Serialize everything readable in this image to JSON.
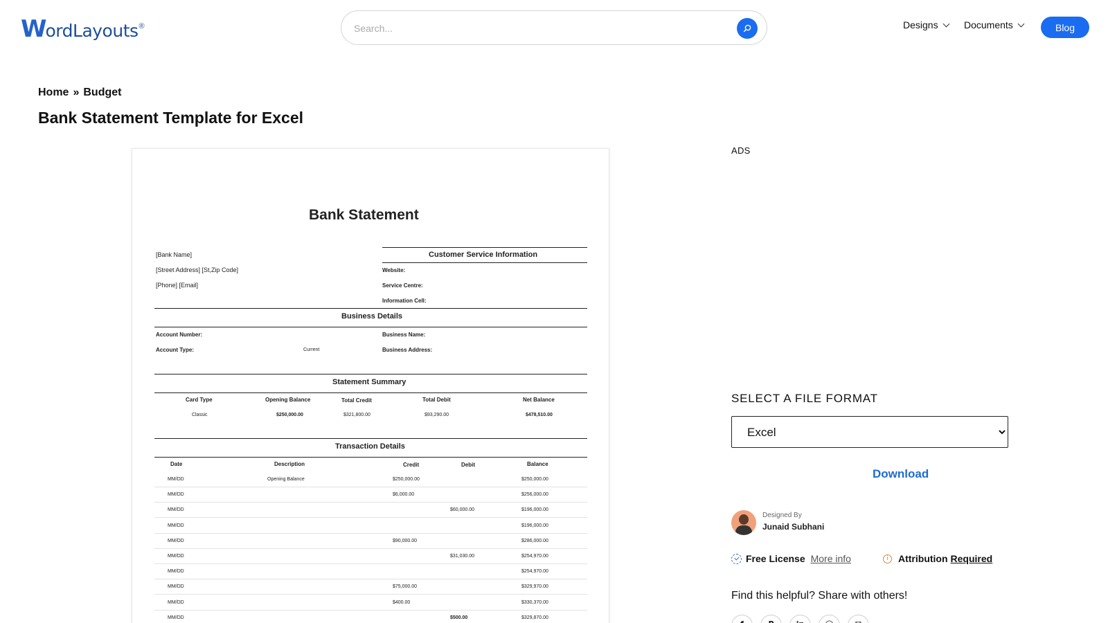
{
  "header": {
    "logo_first": "W",
    "logo_rest": "ordLayouts",
    "logo_reg": "®",
    "search_placeholder": "Search...",
    "nav": [
      {
        "label": "Designs"
      },
      {
        "label": "Documents"
      }
    ],
    "blog_label": "Blog"
  },
  "breadcrumb": {
    "home": "Home",
    "separator": "»",
    "current": "Budget"
  },
  "page_title": "Bank Statement Template for Excel",
  "document": {
    "title": "Bank Statement",
    "bank_lines": [
      "[Bank Name]",
      "[Street Address] [St,Zip Code]",
      "[Phone] [Email]"
    ],
    "customer_service": {
      "heading": "Customer Service Information",
      "fields": [
        "Website:",
        "Service Centre:",
        "Information Cell:"
      ]
    },
    "business_details": {
      "heading": "Business Details",
      "account_number_label": "Account Number:",
      "account_type_label": "Account Type:",
      "account_type_value": "Current",
      "business_name_label": "Business Name:",
      "business_address_label": "Business Address:"
    },
    "statement_summary": {
      "heading": "Statement Summary",
      "columns": [
        "Card Type",
        "Opening Balance",
        "Total Credit",
        "Total Debit",
        "Net Balance"
      ],
      "row": [
        "Classic",
        "$250,000.00",
        "$321,800.00",
        "$93,290.00",
        "$478,510.00"
      ]
    },
    "transactions": {
      "heading": "Transaction Details",
      "columns": [
        "Date",
        "Description",
        "Credit",
        "Debit",
        "Balance"
      ],
      "rows": [
        {
          "date": "MM/DD",
          "description": "Opening Balance",
          "credit": "$250,000.00",
          "debit": "",
          "balance": "$250,000.00"
        },
        {
          "date": "MM/DD",
          "description": "",
          "credit": "$6,000.00",
          "debit": "",
          "balance": "$256,000.00"
        },
        {
          "date": "MM/DD",
          "description": "",
          "credit": "",
          "debit": "$60,000.00",
          "balance": "$196,000.00"
        },
        {
          "date": "MM/DD",
          "description": "",
          "credit": "",
          "debit": "",
          "balance": "$196,000.00"
        },
        {
          "date": "MM/DD",
          "description": "",
          "credit": "$90,000.00",
          "debit": "",
          "balance": "$286,000.00"
        },
        {
          "date": "MM/DD",
          "description": "",
          "credit": "",
          "debit": "$31,030.00",
          "balance": "$254,970.00"
        },
        {
          "date": "MM/DD",
          "description": "",
          "credit": "",
          "debit": "",
          "balance": "$254,970.00"
        },
        {
          "date": "MM/DD",
          "description": "",
          "credit": "$75,000.00",
          "debit": "",
          "balance": "$329,970.00"
        },
        {
          "date": "MM/DD",
          "description": "",
          "credit": "$400.00",
          "debit": "",
          "balance": "$330,370.00"
        },
        {
          "date": "MM/DD",
          "description": "",
          "credit": "",
          "debit": "$500.00",
          "balance": "$329,870.00"
        }
      ]
    }
  },
  "sidebar": {
    "ads_label": "ADS",
    "select_label": "SELECT A FILE FORMAT",
    "formats": [
      "Excel"
    ],
    "selected_format": "Excel",
    "download_label": "Download",
    "designed_by_label": "Designed By",
    "designer_name": "Junaid Subhani",
    "license_label": "Free License",
    "more_info_label": "More info",
    "attribution_label": "Attribution",
    "attribution_link": "Required",
    "share_text": "Find this helpful? Share with others!",
    "share_icons": [
      {
        "name": "facebook-icon",
        "glyph": "f"
      },
      {
        "name": "pinterest-icon",
        "glyph": "P"
      },
      {
        "name": "linkedin-icon",
        "glyph": "in"
      },
      {
        "name": "whatsapp-icon",
        "glyph": "◯"
      },
      {
        "name": "email-icon",
        "glyph": "✉"
      }
    ]
  },
  "colors": {
    "accent": "#1a6cf0",
    "link": "#1d6bd6",
    "logo": "#1d4e9a"
  }
}
